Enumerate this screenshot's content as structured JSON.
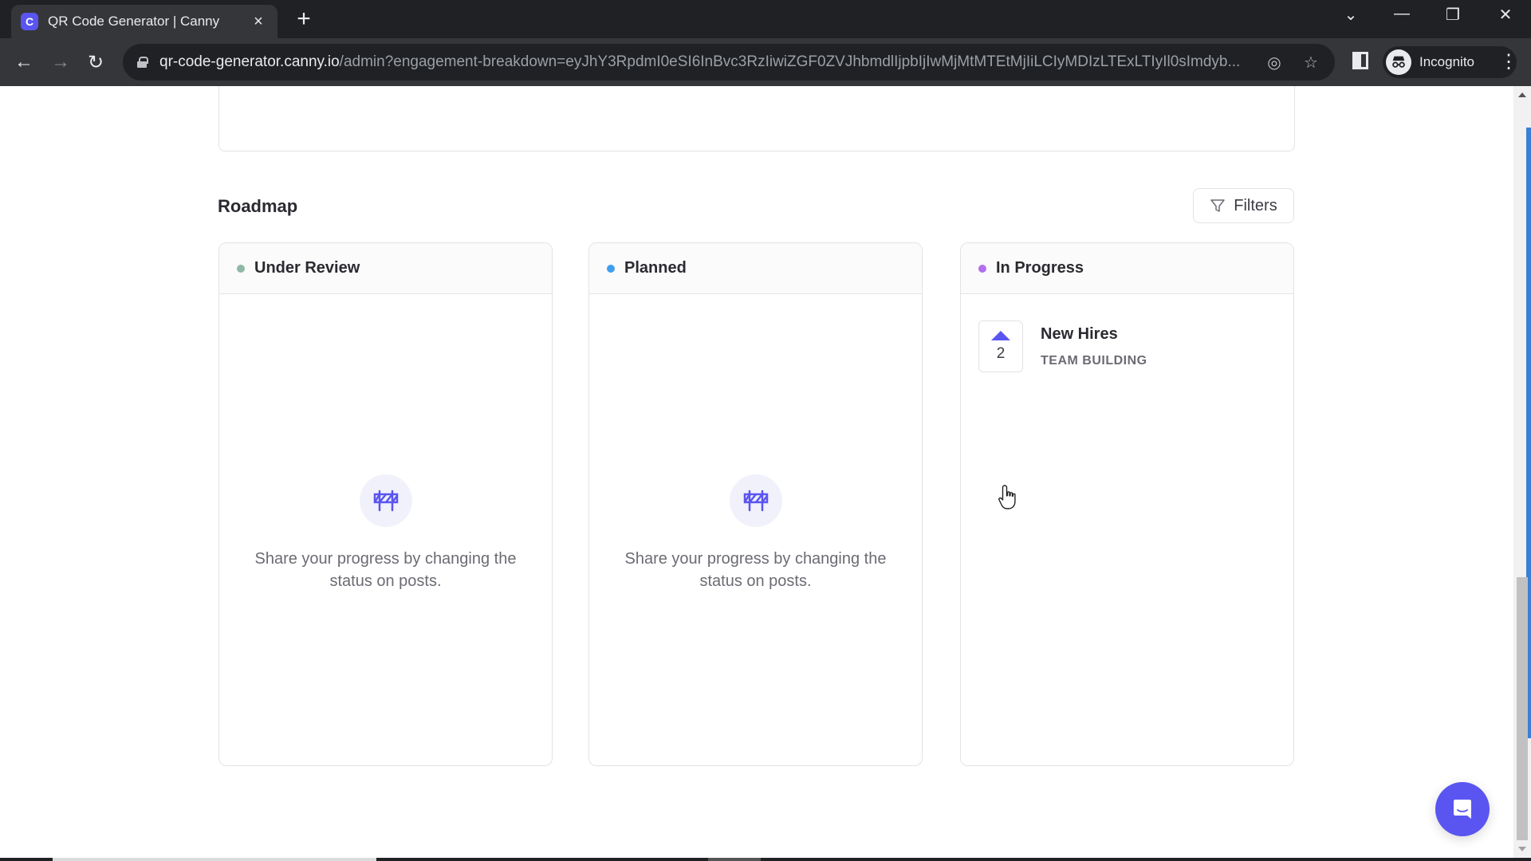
{
  "browser": {
    "tab_title": "QR Code Generator | Canny",
    "tab_favicon_letter": "C",
    "tab_close_glyph": "×",
    "new_tab_glyph": "+",
    "url_host": "qr-code-generator.canny.io",
    "url_path": "/admin?engagement-breakdown=eyJhY3RpdmI0eSI6InBvc3RzIiwiZGF0ZVJhbmdlIjpbIjIwMjMtMTEtMjIiLCIyMDIzLTExLTIyIl0sImdyb...",
    "profile_label": "Incognito",
    "icons": {
      "back": "←",
      "forward": "→",
      "reload": "↻",
      "tab_search": "⌄",
      "minimize": "—",
      "restore": "❐",
      "close": "✕",
      "eye_off": "◎",
      "star": "☆",
      "menu": "⋮",
      "incognito": "🕶"
    }
  },
  "roadmap": {
    "title": "Roadmap",
    "filters_label": "Filters",
    "columns": [
      {
        "name": "Under Review",
        "color": "#8fb8a5",
        "empty_text": "Share your progress by changing the status on posts."
      },
      {
        "name": "Planned",
        "color": "#3e9ff0",
        "empty_text": "Share your progress by changing the status on posts."
      },
      {
        "name": "In Progress",
        "color": "#b46ef0",
        "posts": [
          {
            "title": "New Hires",
            "category": "TEAM BUILDING",
            "votes": "2"
          }
        ]
      }
    ]
  },
  "colors": {
    "accent": "#5a55f0"
  }
}
